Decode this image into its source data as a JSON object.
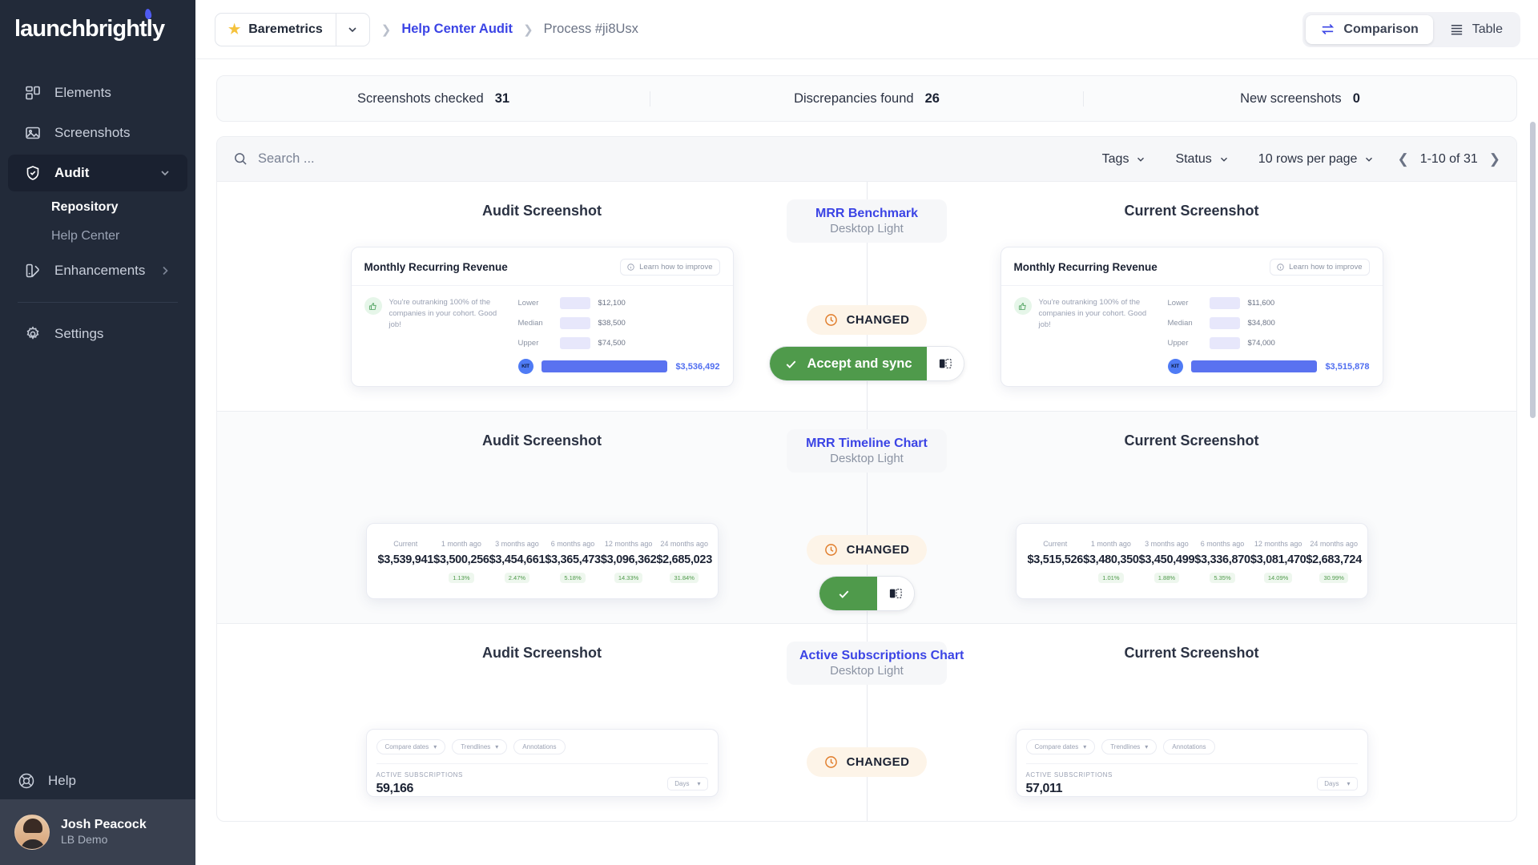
{
  "brand": {
    "name": "launchbrightly"
  },
  "sidebar": {
    "items": [
      {
        "label": "Elements",
        "icon": "elements-icon"
      },
      {
        "label": "Screenshots",
        "icon": "image-icon"
      },
      {
        "label": "Audit",
        "icon": "shield-check-icon"
      }
    ],
    "sub_items": [
      {
        "label": "Repository"
      },
      {
        "label": "Help Center"
      }
    ],
    "enhancements": {
      "label": "Enhancements",
      "icon": "palette-icon"
    },
    "settings": {
      "label": "Settings",
      "icon": "gear-icon"
    },
    "help": {
      "label": "Help",
      "icon": "lifebuoy-icon"
    },
    "user": {
      "name": "Josh Peacock",
      "org": "LB Demo"
    }
  },
  "topbar": {
    "project": "Baremetrics",
    "breadcrumb": {
      "link": "Help Center Audit",
      "current": "Process #ji8Usx"
    },
    "views": [
      {
        "label": "Comparison",
        "icon": "compare-arrows-icon",
        "active": true
      },
      {
        "label": "Table",
        "icon": "table-rows-icon",
        "active": false
      }
    ]
  },
  "stats": [
    {
      "label": "Screenshots checked",
      "value": "31"
    },
    {
      "label": "Discrepancies found",
      "value": "26"
    },
    {
      "label": "New screenshots",
      "value": "0"
    }
  ],
  "toolbar": {
    "search_placeholder": "Search ...",
    "tags": "Tags",
    "status": "Status",
    "rows_per_page": "10 rows per page",
    "pagination": "1-10 of 31"
  },
  "columns": {
    "left": "Audit Screenshot",
    "right": "Current Screenshot"
  },
  "rows": [
    {
      "name": "MRR Benchmark",
      "variant": "Desktop Light",
      "status": "CHANGED",
      "accept_label": "Accept and sync",
      "left": {
        "title": "Monthly Recurring Revenue",
        "learn": "Learn how to improve",
        "blurb": "You're outranking 100% of the companies in your cohort. Good job!",
        "bars": [
          {
            "label": "Lower",
            "value": "$12,100"
          },
          {
            "label": "Median",
            "value": "$38,500"
          },
          {
            "label": "Upper",
            "value": "$74,500"
          }
        ],
        "total": "$3,536,492",
        "badge": "KIT"
      },
      "right": {
        "title": "Monthly Recurring Revenue",
        "learn": "Learn how to improve",
        "blurb": "You're outranking 100% of the companies in your cohort. Good job!",
        "bars": [
          {
            "label": "Lower",
            "value": "$11,600"
          },
          {
            "label": "Median",
            "value": "$34,800"
          },
          {
            "label": "Upper",
            "value": "$74,000"
          }
        ],
        "total": "$3,515,878",
        "badge": "KIT"
      }
    },
    {
      "name": "MRR Timeline Chart",
      "variant": "Desktop Light",
      "status": "CHANGED",
      "accept_label": "",
      "left": {
        "cells": [
          {
            "label": "Current",
            "value": "$3,539,941",
            "pct": ""
          },
          {
            "label": "1 month ago",
            "value": "$3,500,256",
            "pct": "1.13%"
          },
          {
            "label": "3 months ago",
            "value": "$3,454,661",
            "pct": "2.47%"
          },
          {
            "label": "6 months ago",
            "value": "$3,365,473",
            "pct": "5.18%"
          },
          {
            "label": "12 months ago",
            "value": "$3,096,362",
            "pct": "14.33%"
          },
          {
            "label": "24 months ago",
            "value": "$2,685,023",
            "pct": "31.84%"
          }
        ]
      },
      "right": {
        "cells": [
          {
            "label": "Current",
            "value": "$3,515,526",
            "pct": ""
          },
          {
            "label": "1 month ago",
            "value": "$3,480,350",
            "pct": "1.01%"
          },
          {
            "label": "3 months ago",
            "value": "$3,450,499",
            "pct": "1.88%"
          },
          {
            "label": "6 months ago",
            "value": "$3,336,870",
            "pct": "5.35%"
          },
          {
            "label": "12 months ago",
            "value": "$3,081,470",
            "pct": "14.09%"
          },
          {
            "label": "24 months ago",
            "value": "$2,683,724",
            "pct": "30.99%"
          }
        ]
      }
    },
    {
      "name": "Active Subscriptions Chart",
      "variant": "Desktop Light",
      "status": "CHANGED",
      "left": {
        "chips": [
          "Compare dates",
          "Trendlines",
          "Annotations"
        ],
        "label": "ACTIVE SUBSCRIPTIONS",
        "value": "59,166",
        "select": "Days"
      },
      "right": {
        "chips": [
          "Compare dates",
          "Trendlines",
          "Annotations"
        ],
        "label": "ACTIVE SUBSCRIPTIONS",
        "value": "57,011",
        "select": "Days"
      }
    }
  ],
  "colors": {
    "accent": "#3b44e5",
    "sidebar": "#222a39",
    "accept_green": "#4f9a4b",
    "changed_bg": "#fdf4e8",
    "changed_icon": "#e07b28",
    "star": "#f5c23c"
  }
}
